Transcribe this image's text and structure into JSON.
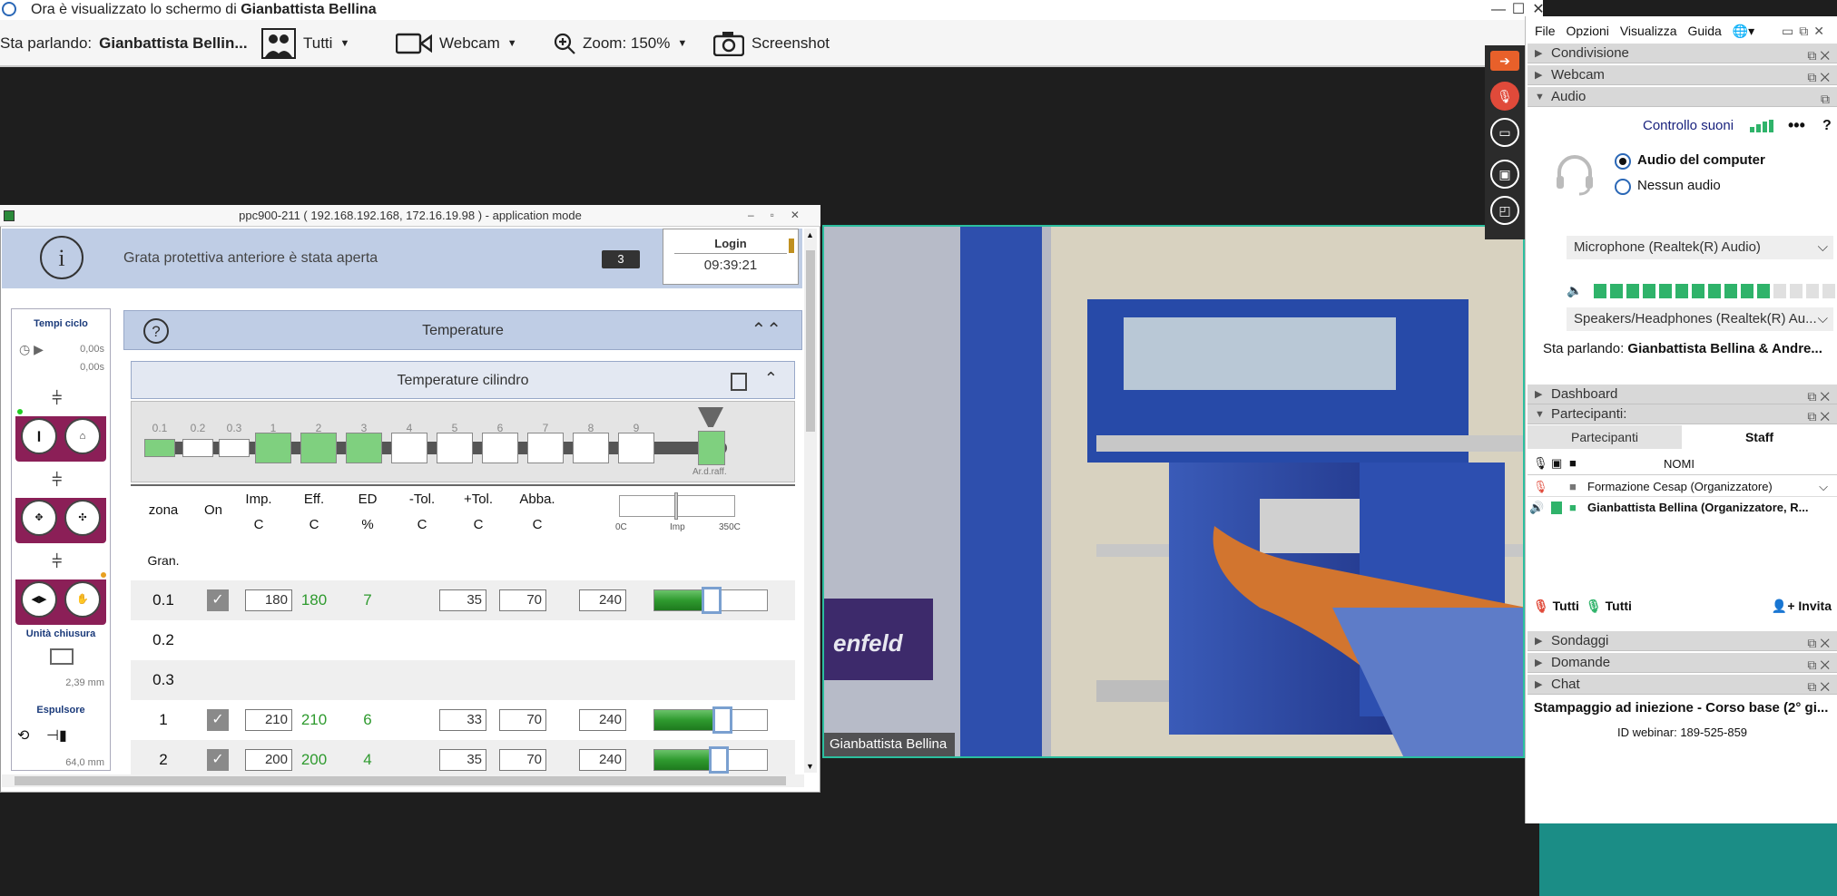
{
  "window": {
    "title_prefix": "Ora è visualizzato lo schermo di",
    "title_presenter": "Gianbattista Bellina",
    "controls": [
      "—",
      "☐",
      "✕"
    ]
  },
  "toolbar": {
    "speaking_label": "Sta parlando:",
    "speaking_name": "Gianbattista  Bellin...",
    "tutti": "Tutti",
    "webcam": "Webcam",
    "zoom": "Zoom: 150%",
    "screenshot": "Screenshot"
  },
  "ppc": {
    "title": "ppc900-211 ( 192.168.192.168, 172.16.19.98 ) - application mode",
    "message": "Grata protettiva anteriore è stata aperta",
    "message_count": "3",
    "login_label": "Login",
    "time": "09:39:21",
    "left": {
      "tempi_ciclo": "Tempi ciclo",
      "t1": "0,00s",
      "t2": "0,00s",
      "unita_chiusura": "Unità chiusura",
      "chiusura_val": "2,39 mm",
      "espulsore": "Espulsore",
      "espulsore_val": "64,0 mm"
    },
    "temperature_title": "Temperature",
    "cylinder_title": "Temperature cilindro",
    "zones": [
      "0.1",
      "0.2",
      "0.3",
      "1",
      "2",
      "3",
      "4",
      "5",
      "6",
      "7",
      "8",
      "9"
    ],
    "zone_active": [
      true,
      false,
      false,
      true,
      true,
      true,
      false,
      false,
      false,
      false,
      false,
      false,
      false
    ],
    "nozzle_caption": "Ar.d.raff.",
    "columns": [
      {
        "top": "zona",
        "bottom": ""
      },
      {
        "top": "On",
        "bottom": ""
      },
      {
        "top": "Imp.",
        "bottom": "C"
      },
      {
        "top": "Eff.",
        "bottom": "C"
      },
      {
        "top": "ED",
        "bottom": "%"
      },
      {
        "top": "-Tol.",
        "bottom": "C"
      },
      {
        "top": "+Tol.",
        "bottom": "C"
      },
      {
        "top": "Abba.",
        "bottom": "C"
      }
    ],
    "scale": {
      "min": "0C",
      "mid": "Imp",
      "max": "350C"
    },
    "rows": [
      {
        "zona": "Gran.",
        "on": false,
        "imp": "",
        "eff": "",
        "ed": "",
        "tol_minus": "",
        "tol_plus": "",
        "abba": ""
      },
      {
        "zona": "0.1",
        "on": true,
        "imp": "180",
        "eff": "180",
        "ed": "7",
        "tol_minus": "35",
        "tol_plus": "70",
        "abba": "240",
        "level": 0.51
      },
      {
        "zona": "0.2",
        "on": false,
        "imp": "",
        "eff": "",
        "ed": "",
        "tol_minus": "",
        "tol_plus": "",
        "abba": ""
      },
      {
        "zona": "0.3",
        "on": false,
        "imp": "",
        "eff": "",
        "ed": "",
        "tol_minus": "",
        "tol_plus": "",
        "abba": ""
      },
      {
        "zona": "1",
        "on": true,
        "imp": "210",
        "eff": "210",
        "ed": "6",
        "tol_minus": "33",
        "tol_plus": "70",
        "abba": "240",
        "level": 0.6
      },
      {
        "zona": "2",
        "on": true,
        "imp": "200",
        "eff": "200",
        "ed": "4",
        "tol_minus": "35",
        "tol_plus": "70",
        "abba": "240",
        "level": 0.57
      }
    ]
  },
  "video": {
    "label": "Gianbattista Bellina",
    "overlay_text": "enfeld"
  },
  "panel": {
    "menu": [
      "File",
      "Opzioni",
      "Visualizza",
      "Guida"
    ],
    "sections_top": [
      "Condivisione",
      "Webcam",
      "Audio"
    ],
    "controllo_suoni": "Controllo suoni",
    "audio_computer": "Audio del computer",
    "nessun_audio": "Nessun audio",
    "microphone": "Microphone (Realtek(R) Audio)",
    "speakers": "Speakers/Headphones (Realtek(R) Au...",
    "mic_level": 0.7,
    "speaking_label": "Sta parlando:",
    "speaking_names": "Gianbattista Bellina & Andre...",
    "dashboard": "Dashboard",
    "partecipanti_section": "Partecipanti:",
    "tab_partecipanti": "Partecipanti",
    "tab_staff": "Staff",
    "nomi": "NOMI",
    "participants": [
      "Formazione Cesap (Organizzatore)",
      "Gianbattista Bellina (Organizzatore, R..."
    ],
    "mute_all": "Tutti",
    "unmute_all": "Tutti",
    "invite": "Invita",
    "sections_bottom": [
      "Sondaggi",
      "Domande",
      "Chat"
    ],
    "webinar_title": "Stampaggio ad iniezione - Corso base (2° gi...",
    "webinar_id": "ID webinar: 189-525-859",
    "accent": "#1a237e",
    "green": "#2fb36a"
  }
}
